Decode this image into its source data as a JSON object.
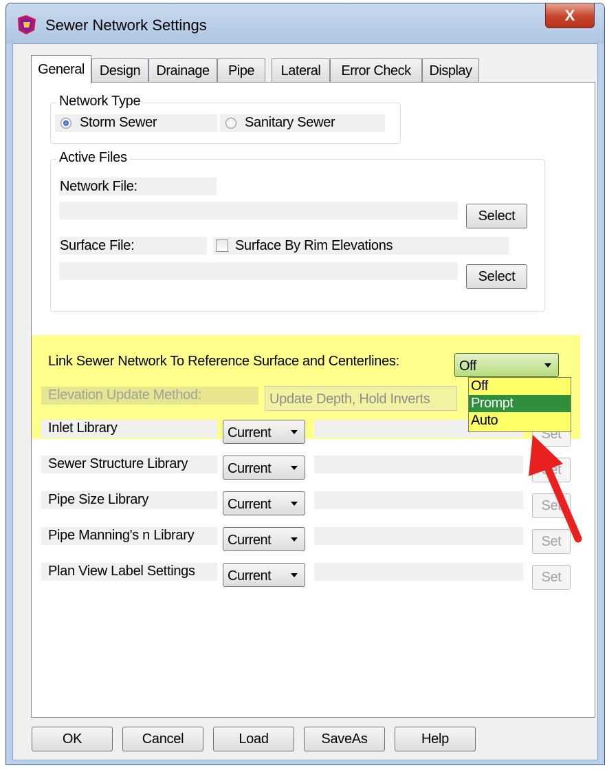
{
  "window": {
    "title": "Sewer Network Settings",
    "close_label": "X"
  },
  "tabs": [
    "General",
    "Design",
    "Drainage",
    "Pipe",
    "Lateral",
    "Error Check",
    "Display"
  ],
  "network_type": {
    "legend": "Network Type",
    "options": [
      "Storm Sewer",
      "Sanitary Sewer"
    ],
    "selected": "Storm Sewer"
  },
  "active_files": {
    "legend": "Active Files",
    "network_file_label": "Network File:",
    "network_file_value": "",
    "surface_file_label": "Surface File:",
    "surface_file_value": "",
    "surface_by_rim_label": "Surface By Rim Elevations",
    "select_label": "Select"
  },
  "link": {
    "label": "Link Sewer Network To Reference Surface and Centerlines:",
    "value": "Off",
    "options": [
      "Off",
      "Prompt",
      "Auto"
    ],
    "highlighted_option": "Prompt"
  },
  "elevation": {
    "label": "Elevation Update Method:",
    "value": "Update Depth, Hold Inverts"
  },
  "libraries": [
    {
      "label": "Inlet Library",
      "value": "Current",
      "button": "Set"
    },
    {
      "label": "Sewer Structure Library",
      "value": "Current",
      "button": "Set"
    },
    {
      "label": "Pipe Size Library",
      "value": "Current",
      "button": "Set"
    },
    {
      "label": "Pipe Manning's n Library",
      "value": "Current",
      "button": "Set"
    },
    {
      "label": "Plan View Label Settings",
      "value": "Current",
      "button": "Set"
    }
  ],
  "footer": {
    "ok": "OK",
    "cancel": "Cancel",
    "load": "Load",
    "saveas": "SaveAs",
    "help": "Help"
  },
  "colors": {
    "highlight": "#ffff66",
    "arrow": "#e8201e",
    "selected_option": "#2f8f3b"
  }
}
